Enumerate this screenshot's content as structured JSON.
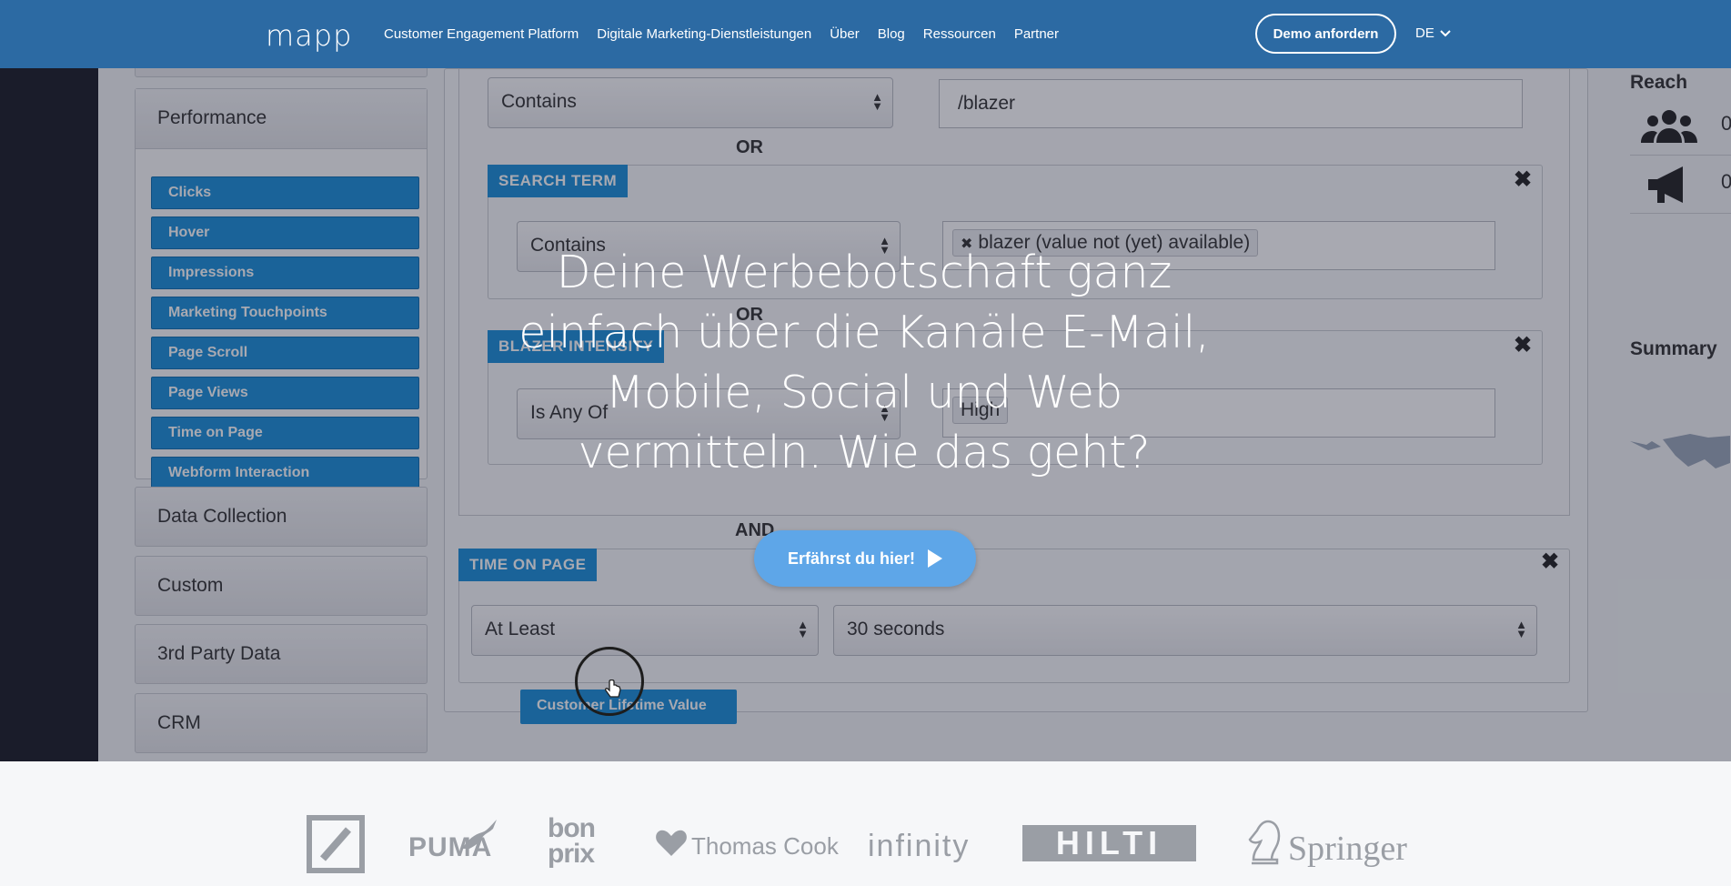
{
  "nav": {
    "logo": "mapp",
    "links": [
      "Customer Engagement Platform",
      "Digitale Marketing-Dienstleistungen",
      "Über",
      "Blog",
      "Ressourcen",
      "Partner"
    ],
    "demo_button": "Demo anfordern",
    "language": "DE"
  },
  "sidebar": {
    "performance": "Performance",
    "performance_items": [
      "Clicks",
      "Hover",
      "Impressions",
      "Marketing Touchpoints",
      "Page Scroll",
      "Page Views",
      "Time on Page",
      "Webform Interaction"
    ],
    "sections": [
      "Data Collection",
      "Custom",
      "3rd Party Data",
      "CRM"
    ]
  },
  "builder": {
    "rule1_operator": "Contains",
    "rule1_value": "/blazer",
    "or1": "OR",
    "search_term_tag": "SEARCH TERM",
    "rule2_operator": "Contains",
    "rule2_chip": "blazer (value not (yet) available)",
    "or2": "OR",
    "rule3_tag": "BLAZER INTENSITY",
    "rule3_operator": "Is Any Of",
    "rule3_chip": "High",
    "and": "AND",
    "time_tag": "TIME ON PAGE",
    "time_operator": "At Least",
    "time_value": "30 seconds",
    "clv_button": "Customer Lifetime Value"
  },
  "right": {
    "reach": "Reach",
    "reach_val1": "0",
    "reach_val2": "0",
    "summary": "Summary"
  },
  "hero": {
    "headline_lines": [
      "Deine Werbebotschaft ganz",
      "einfach über die Kanäle E-Mail,",
      "Mobile, Social und Web",
      "vermitteln. Wie das geht?"
    ],
    "cta": "Erfährst du hier!"
  },
  "logos": {
    "puma": "PUMA",
    "bonprix_top": "bon",
    "bonprix_bottom": "prix",
    "thomascook": "Thomas Cook",
    "infinity": "infinity",
    "hilti": "HILTI",
    "springer": "Springer"
  },
  "colors": {
    "nav_bg": "#2c6aa3",
    "accent_blue": "#1a8fd8",
    "cta_blue": "#5ea6e8"
  }
}
